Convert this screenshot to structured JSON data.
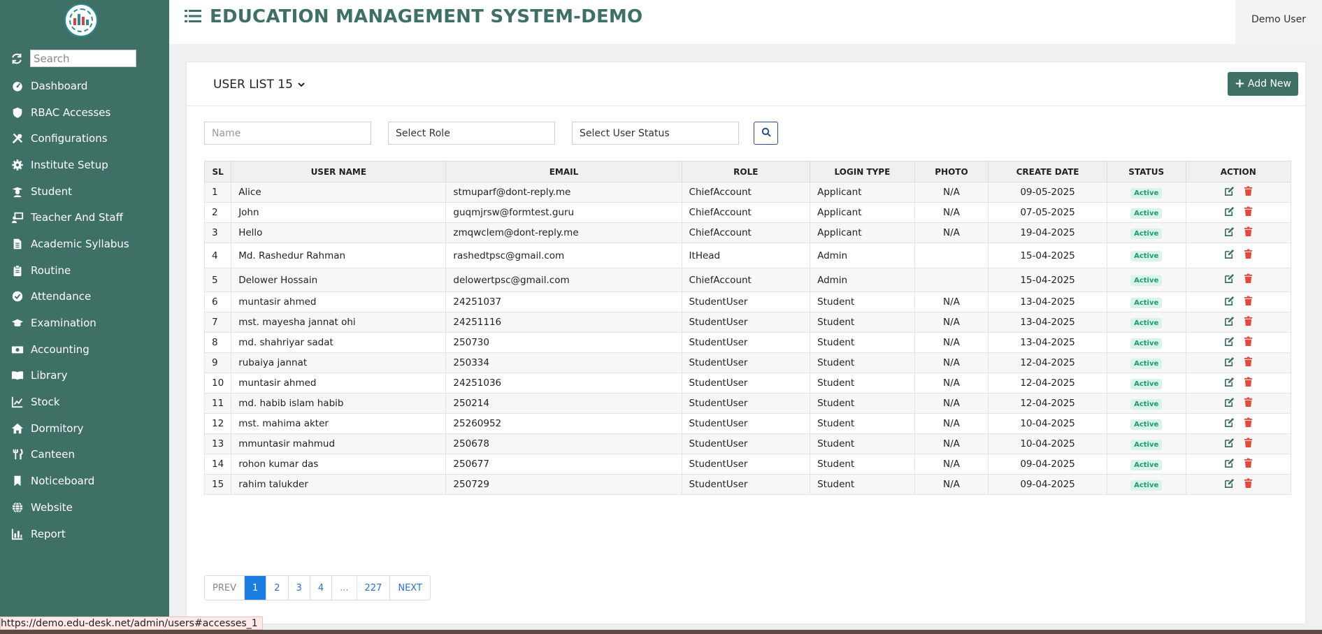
{
  "sidebar": {
    "search_placeholder": "Search",
    "items": [
      {
        "label": "Dashboard",
        "icon": "dashboard-icon"
      },
      {
        "label": "RBAC Accesses",
        "icon": "shield-icon"
      },
      {
        "label": "Configurations",
        "icon": "tools-icon"
      },
      {
        "label": "Institute Setup",
        "icon": "gear-icon"
      },
      {
        "label": "Student",
        "icon": "graduate-icon"
      },
      {
        "label": "Teacher And Staff",
        "icon": "teacher-icon"
      },
      {
        "label": "Academic Syllabus",
        "icon": "document-icon"
      },
      {
        "label": "Routine",
        "icon": "clipboard-icon"
      },
      {
        "label": "Attendance",
        "icon": "check-circle-icon"
      },
      {
        "label": "Examination",
        "icon": "cap-icon"
      },
      {
        "label": "Accounting",
        "icon": "money-icon"
      },
      {
        "label": "Library",
        "icon": "book-icon"
      },
      {
        "label": "Stock",
        "icon": "chart-line-icon"
      },
      {
        "label": "Dormitory",
        "icon": "home-icon"
      },
      {
        "label": "Canteen",
        "icon": "utensils-icon"
      },
      {
        "label": "Noticeboard",
        "icon": "bookmark-icon"
      },
      {
        "label": "Website",
        "icon": "globe-icon"
      },
      {
        "label": "Report",
        "icon": "chart-area-icon"
      }
    ]
  },
  "header": {
    "title": "EDUCATION MANAGEMENT SYSTEM-DEMO",
    "user": "Demo User"
  },
  "card": {
    "title": "USER LIST 15",
    "add_label": "Add New"
  },
  "filters": {
    "name_placeholder": "Name",
    "role": "Select Role",
    "status": "Select User Status"
  },
  "table": {
    "headers": [
      "SL",
      "USER NAME",
      "EMAIL",
      "ROLE",
      "LOGIN TYPE",
      "PHOTO",
      "CREATE DATE",
      "STATUS",
      "ACTION"
    ],
    "rows": [
      {
        "sl": "1",
        "name": "Alice",
        "email": "stmuparf@dont-reply.me",
        "role": "ChiefAccount",
        "login": "Applicant",
        "photo": "N/A",
        "date": "09-05-2025",
        "status": "Active"
      },
      {
        "sl": "2",
        "name": "John",
        "email": "guqmjrsw@formtest.guru",
        "role": "ChiefAccount",
        "login": "Applicant",
        "photo": "N/A",
        "date": "07-05-2025",
        "status": "Active"
      },
      {
        "sl": "3",
        "name": "Hello",
        "email": "zmqwclem@dont-reply.me",
        "role": "ChiefAccount",
        "login": "Applicant",
        "photo": "N/A",
        "date": "19-04-2025",
        "status": "Active"
      },
      {
        "sl": "4",
        "name": "Md. Rashedur Rahman",
        "email": "rashedtpsc@gmail.com",
        "role": "ItHead",
        "login": "Admin",
        "photo": "",
        "date": "15-04-2025",
        "status": "Active"
      },
      {
        "sl": "5",
        "name": "Delower Hossain",
        "email": "delowertpsc@gmail.com",
        "role": "ChiefAccount",
        "login": "Admin",
        "photo": "",
        "date": "15-04-2025",
        "status": "Active"
      },
      {
        "sl": "6",
        "name": "muntasir ahmed",
        "email": "24251037",
        "role": "StudentUser",
        "login": "Student",
        "photo": "N/A",
        "date": "13-04-2025",
        "status": "Active"
      },
      {
        "sl": "7",
        "name": "mst. mayesha jannat ohi",
        "email": "24251116",
        "role": "StudentUser",
        "login": "Student",
        "photo": "N/A",
        "date": "13-04-2025",
        "status": "Active"
      },
      {
        "sl": "8",
        "name": "md. shahriyar sadat",
        "email": "250730",
        "role": "StudentUser",
        "login": "Student",
        "photo": "N/A",
        "date": "13-04-2025",
        "status": "Active"
      },
      {
        "sl": "9",
        "name": "rubaiya jannat",
        "email": "250334",
        "role": "StudentUser",
        "login": "Student",
        "photo": "N/A",
        "date": "12-04-2025",
        "status": "Active"
      },
      {
        "sl": "10",
        "name": "muntasir ahmed",
        "email": "24251036",
        "role": "StudentUser",
        "login": "Student",
        "photo": "N/A",
        "date": "12-04-2025",
        "status": "Active"
      },
      {
        "sl": "11",
        "name": "md. habib islam habib",
        "email": "250214",
        "role": "StudentUser",
        "login": "Student",
        "photo": "N/A",
        "date": "12-04-2025",
        "status": "Active"
      },
      {
        "sl": "12",
        "name": "mst. mahima akter",
        "email": "25260952",
        "role": "StudentUser",
        "login": "Student",
        "photo": "N/A",
        "date": "10-04-2025",
        "status": "Active"
      },
      {
        "sl": "13",
        "name": "mmuntasir mahmud",
        "email": "250678",
        "role": "StudentUser",
        "login": "Student",
        "photo": "N/A",
        "date": "10-04-2025",
        "status": "Active"
      },
      {
        "sl": "14",
        "name": "rohon kumar das",
        "email": "250677",
        "role": "StudentUser",
        "login": "Student",
        "photo": "N/A",
        "date": "09-04-2025",
        "status": "Active"
      },
      {
        "sl": "15",
        "name": "rahim talukder",
        "email": "250729",
        "role": "StudentUser",
        "login": "Student",
        "photo": "N/A",
        "date": "09-04-2025",
        "status": "Active"
      }
    ]
  },
  "pagination": {
    "prev": "PREV",
    "pages": [
      "1",
      "2",
      "3",
      "4",
      "...",
      "227"
    ],
    "active": "1",
    "next": "NEXT"
  },
  "status_bar": {
    "url": "https://demo.edu-desk.net/admin/users#accesses_1"
  },
  "colors": {
    "sidebar": "#3e7065",
    "title": "#3e7065",
    "active_page": "#1a7de0",
    "delete": "#e14b3c",
    "badge_bg": "#d8f3ea",
    "badge_text": "#1f9a6e"
  }
}
